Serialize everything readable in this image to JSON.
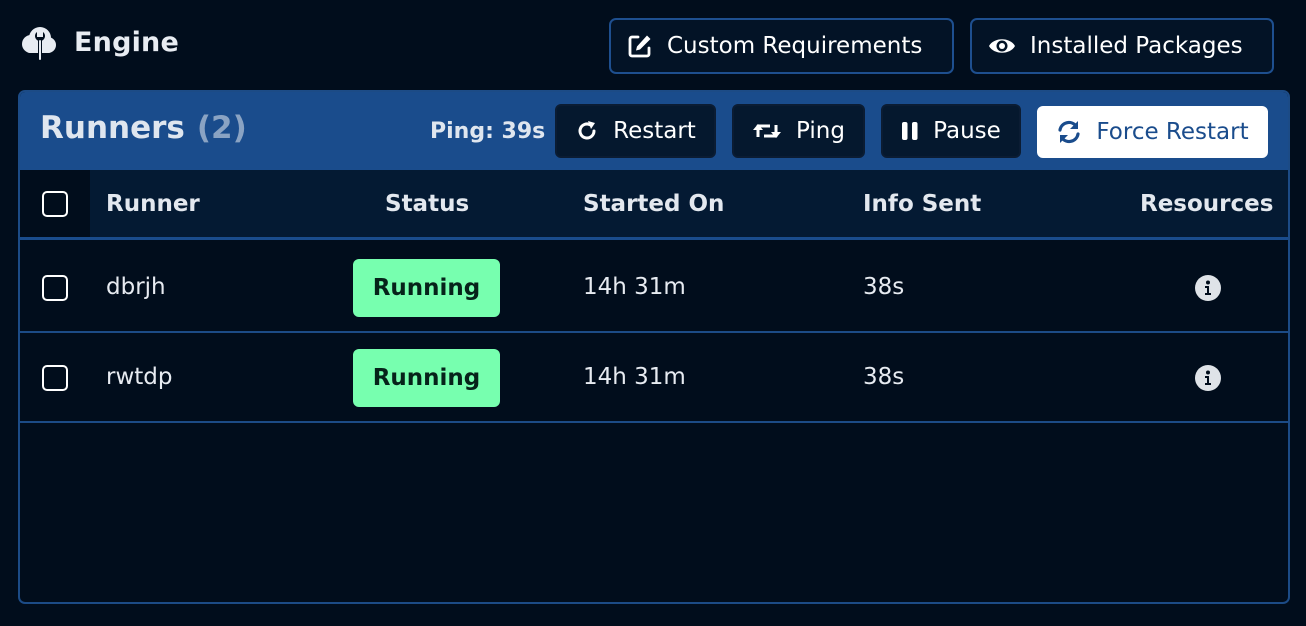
{
  "header": {
    "title": "Engine",
    "title_icon": "cloud-wrench-icon",
    "buttons": [
      {
        "label": "Custom Requirements",
        "icon": "edit-icon"
      },
      {
        "label": "Installed Packages",
        "icon": "eye-icon"
      }
    ]
  },
  "panel": {
    "title": "Runners",
    "count": "(2)",
    "ping": "Ping: 39s",
    "actions": {
      "restart": {
        "label": "Restart",
        "icon": "rotate-icon"
      },
      "ping": {
        "label": "Ping",
        "icon": "retweet-icon"
      },
      "pause": {
        "label": "Pause",
        "icon": "pause-icon"
      },
      "force_restart": {
        "label": "Force Restart",
        "icon": "sync-icon"
      }
    }
  },
  "table": {
    "columns": [
      "Runner",
      "Status",
      "Started On",
      "Info Sent",
      "Resources"
    ],
    "rows": [
      {
        "runner": "dbrjh",
        "status": "Running",
        "started_on": "14h 31m",
        "info_sent": "38s",
        "resources_icon": "info-circle-icon"
      },
      {
        "runner": "rwtdp",
        "status": "Running",
        "started_on": "14h 31m",
        "info_sent": "38s",
        "resources_icon": "info-circle-icon"
      }
    ]
  },
  "colors": {
    "background": "#010d1c",
    "panel_header": "#1a4c8c",
    "table_head": "#041a33",
    "border": "#1c4b86",
    "status_running": "#77ffaf"
  }
}
